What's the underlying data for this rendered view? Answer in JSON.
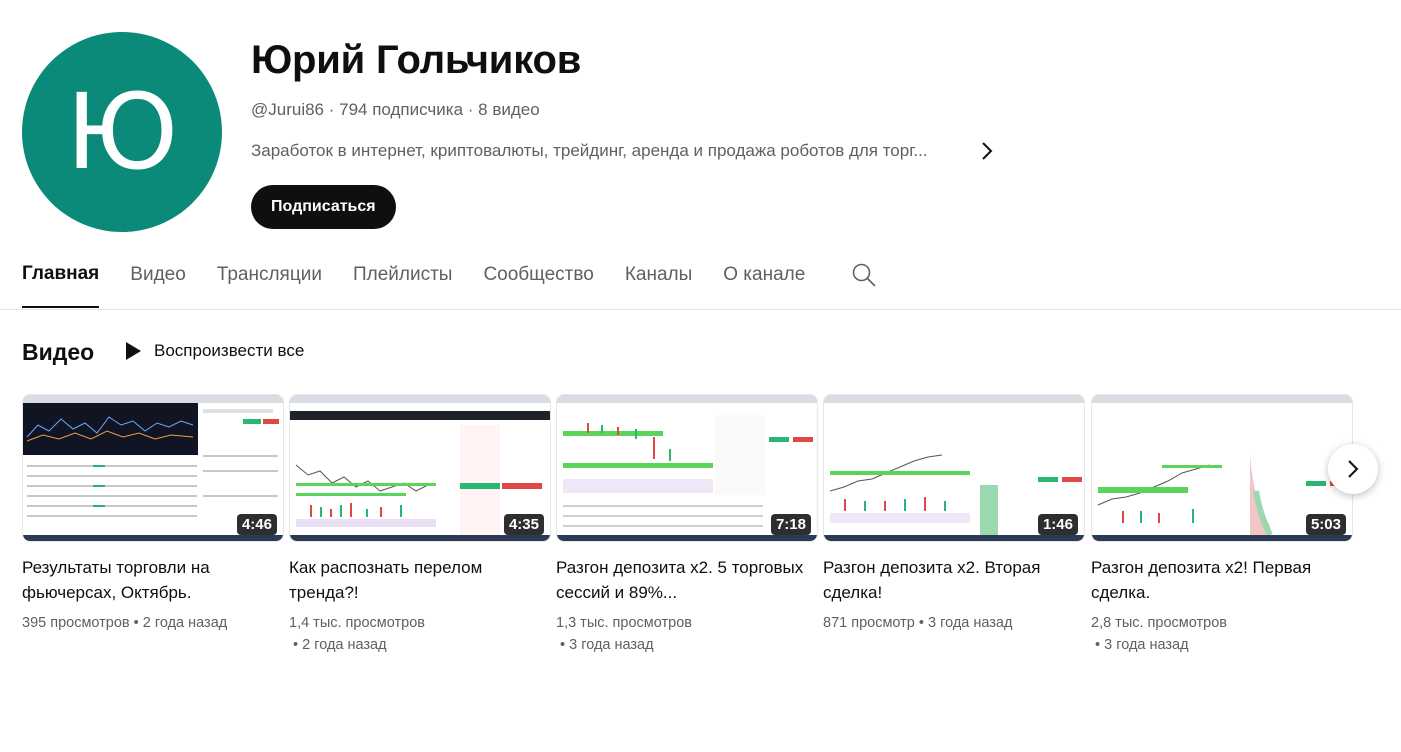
{
  "channel": {
    "avatar_letter": "Ю",
    "avatar_color": "#0b8a7a",
    "name": "Юрий Гольчиков",
    "handle": "@Jurui86",
    "subscribers": "794 подписчика",
    "video_count": "8 видео",
    "separator": " · ",
    "description": "Заработок в интернет, криптовалюты, трейдинг, аренда и продажа роботов для торг...",
    "subscribe_label": "Подписаться"
  },
  "tabs": [
    {
      "label": "Главная",
      "active": true
    },
    {
      "label": "Видео"
    },
    {
      "label": "Трансляции"
    },
    {
      "label": "Плейлисты"
    },
    {
      "label": "Сообщество"
    },
    {
      "label": "Каналы"
    },
    {
      "label": "О канале"
    }
  ],
  "section": {
    "title": "Видео",
    "play_all_label": "Воспроизвести все"
  },
  "videos": [
    {
      "title": "Результаты торговли на фьючерсах, Октябрь.",
      "duration": "4:46",
      "views": "395 просмотров",
      "age": "2 года назад",
      "meta_inline": true
    },
    {
      "title": "Как распознать перелом тренда?!",
      "duration": "4:35",
      "views": "1,4 тыс. просмотров",
      "age": "2 года назад",
      "meta_inline": false
    },
    {
      "title": "Разгон депозита x2. 5 торговых сессий и 89%...",
      "duration": "7:18",
      "views": "1,3 тыс. просмотров",
      "age": "3 года назад",
      "meta_inline": false
    },
    {
      "title": "Разгон депозита x2. Вторая сделка!",
      "duration": "1:46",
      "views": "871 просмотр",
      "age": "3 года назад",
      "meta_inline": true
    },
    {
      "title": "Разгон депозита x2! Первая сделка.",
      "duration": "5:03",
      "views": "2,8 тыс. просмотров",
      "age": "3 года назад",
      "meta_inline": false
    }
  ],
  "icons": {
    "description_more": "chevron-right-icon",
    "search": "search-icon",
    "play_all": "play-icon",
    "carousel_next": "chevron-right-icon"
  }
}
